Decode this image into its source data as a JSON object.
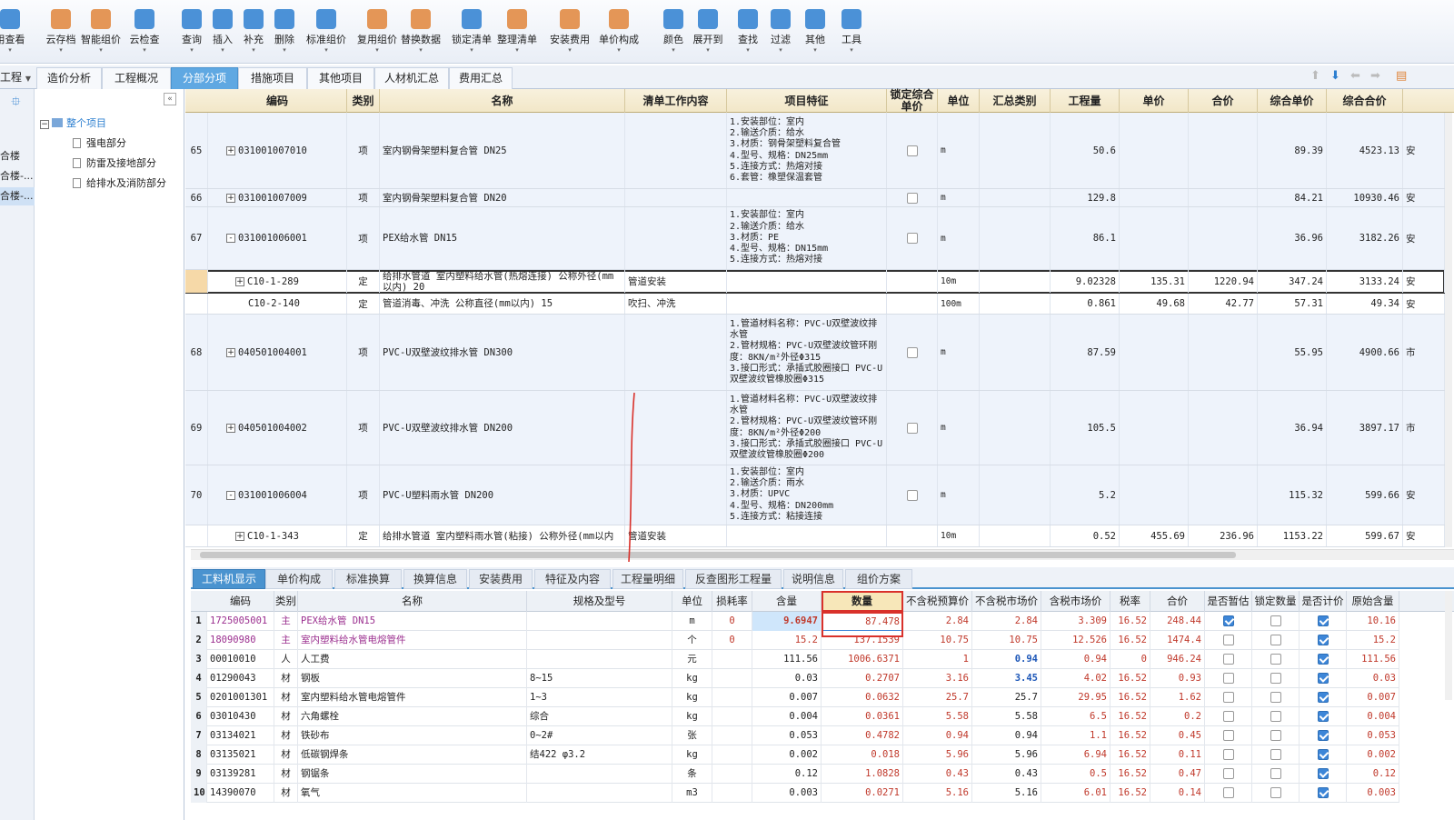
{
  "toolbar": {
    "items": [
      {
        "label": "用查看",
        "icon": "view-icon",
        "color": "#2d7fd0"
      },
      {
        "label": "云存档",
        "icon": "cloud-save-icon",
        "color": "#e0853a"
      },
      {
        "label": "智能组价",
        "icon": "smart-price-icon",
        "color": "#e0853a"
      },
      {
        "label": "云检查",
        "icon": "cloud-check-icon",
        "color": "#2d7fd0"
      },
      {
        "label": "查询",
        "icon": "query-icon",
        "color": "#2d7fd0"
      },
      {
        "label": "插入",
        "icon": "insert-icon",
        "color": "#2d7fd0"
      },
      {
        "label": "补充",
        "icon": "supplement-icon",
        "color": "#2d7fd0"
      },
      {
        "label": "删除",
        "icon": "delete-icon",
        "color": "#2d7fd0"
      },
      {
        "label": "标准组价",
        "icon": "standard-price-icon",
        "color": "#2d7fd0"
      },
      {
        "label": "复用组价",
        "icon": "reuse-price-icon",
        "color": "#e0853a"
      },
      {
        "label": "替换数据",
        "icon": "replace-data-icon",
        "color": "#e0853a"
      },
      {
        "label": "锁定清单",
        "icon": "lock-list-icon",
        "color": "#2d7fd0"
      },
      {
        "label": "整理清单",
        "icon": "organize-list-icon",
        "color": "#e0853a"
      },
      {
        "label": "安装费用",
        "icon": "install-fee-icon",
        "color": "#e0853a"
      },
      {
        "label": "单价构成",
        "icon": "unit-price-icon",
        "color": "#e0853a"
      },
      {
        "label": "颜色",
        "icon": "color-icon",
        "color": "#2d7fd0"
      },
      {
        "label": "展开到",
        "icon": "expand-to-icon",
        "color": "#2d7fd0"
      },
      {
        "label": "查找",
        "icon": "find-icon",
        "color": "#2d7fd0"
      },
      {
        "label": "过滤",
        "icon": "filter-icon",
        "color": "#2d7fd0"
      },
      {
        "label": "其他",
        "icon": "other-icon",
        "color": "#2d7fd0"
      },
      {
        "label": "工具",
        "icon": "tools-icon",
        "color": "#2d7fd0"
      }
    ]
  },
  "tabs": {
    "project_label": "工程",
    "items": [
      "造价分析",
      "工程概况",
      "分部分项",
      "措施项目",
      "其他项目",
      "人材机汇总",
      "费用汇总"
    ],
    "active": "分部分项"
  },
  "left_strip": [
    "合楼",
    "合楼-...",
    "合楼-..."
  ],
  "tree": {
    "root": "整个项目",
    "items": [
      "强电部分",
      "防雷及接地部分",
      "给排水及消防部分"
    ]
  },
  "grid": {
    "headers": [
      "编码",
      "类别",
      "名称",
      "清单工作内容",
      "项目特征",
      "锁定综合单价",
      "单位",
      "汇总类别",
      "工程量",
      "单价",
      "合价",
      "综合单价",
      "综合合价"
    ],
    "rows": [
      {
        "no": "65",
        "code": "031001007010",
        "exp": "+",
        "type": "项",
        "name": "室内钢骨架塑料复合管 DN25",
        "work": "",
        "feat": "1.安装部位：室内\n2.输送介质：给水\n3.材质：钢骨架塑料复合管\n4.型号、规格：DN25mm\n5.连接方式：热熔对接\n6.套管：橡塑保温套管",
        "unit": "m",
        "qty": "50.6",
        "price": "",
        "total": "",
        "cunit": "89.39",
        "ctotal": "4523.13",
        "extra": "安",
        "alt": true
      },
      {
        "no": "66",
        "code": "031001007009",
        "exp": "+",
        "type": "项",
        "name": "室内钢骨架塑料复合管 DN20",
        "work": "",
        "feat": "",
        "unit": "m",
        "qty": "129.8",
        "price": "",
        "total": "",
        "cunit": "84.21",
        "ctotal": "10930.46",
        "extra": "安",
        "alt": true
      },
      {
        "no": "67",
        "code": "031001006001",
        "exp": "-",
        "type": "项",
        "name": "PEX给水管 DN15",
        "work": "",
        "feat": "1.安装部位：室内\n2.输送介质：给水\n3.材质：PE\n4.型号、规格：DN15mm\n5.连接方式：热熔对接",
        "unit": "m",
        "qty": "86.1",
        "price": "",
        "total": "",
        "cunit": "36.96",
        "ctotal": "3182.26",
        "extra": "安",
        "alt": true
      },
      {
        "no": "",
        "code": "C10-1-289",
        "exp": "+",
        "type": "定",
        "name": "给排水管道 室内塑料给水管(热熔连接) 公称外径(mm以内) 20",
        "work": "管道安装",
        "feat": "",
        "unit": "10m",
        "qty": "9.02328",
        "price": "135.31",
        "total": "1220.94",
        "cunit": "347.24",
        "ctotal": "3133.24",
        "extra": "安",
        "alt": false,
        "sel": true
      },
      {
        "no": "",
        "code": "C10-2-140",
        "exp": "",
        "type": "定",
        "name": "管道消毒、冲洗 公称直径(mm以内) 15",
        "work": "吹扫、冲洗",
        "feat": "",
        "unit": "100m",
        "qty": "0.861",
        "price": "49.68",
        "total": "42.77",
        "cunit": "57.31",
        "ctotal": "49.34",
        "extra": "安",
        "alt": false
      },
      {
        "no": "68",
        "code": "040501004001",
        "exp": "+",
        "type": "项",
        "name": "PVC-U双壁波纹排水管 DN300",
        "work": "",
        "feat": "1.管道材料名称：PVC-U双壁波纹排水管\n2.管材规格：PVC-U双壁波纹管环刚度：8KN/m²外径Φ315\n3.接口形式：承插式胶圈接口 PVC-U双壁波纹管橡胶圈Φ315",
        "unit": "m",
        "qty": "87.59",
        "price": "",
        "total": "",
        "cunit": "55.95",
        "ctotal": "4900.66",
        "extra": "市",
        "alt": true
      },
      {
        "no": "69",
        "code": "040501004002",
        "exp": "+",
        "type": "项",
        "name": "PVC-U双壁波纹排水管 DN200",
        "work": "",
        "feat": "1.管道材料名称：PVC-U双壁波纹排水管\n2.管材规格：PVC-U双壁波纹管环刚度：8KN/m²外径Φ200\n3.接口形式：承插式胶圈接口 PVC-U双壁波纹管橡胶圈Φ200",
        "unit": "m",
        "qty": "105.5",
        "price": "",
        "total": "",
        "cunit": "36.94",
        "ctotal": "3897.17",
        "extra": "市",
        "alt": true
      },
      {
        "no": "70",
        "code": "031001006004",
        "exp": "-",
        "type": "项",
        "name": "PVC-U塑料雨水管 DN200",
        "work": "",
        "feat": "1.安装部位：室内\n2.输送介质：雨水\n3.材质：UPVC\n4.型号、规格：DN200mm\n5.连接方式：粘接连接",
        "unit": "m",
        "qty": "5.2",
        "price": "",
        "total": "",
        "cunit": "115.32",
        "ctotal": "599.66",
        "extra": "安",
        "alt": true
      },
      {
        "no": "",
        "code": "C10-1-343",
        "exp": "+",
        "type": "定",
        "name": "给排水管道 室内塑料雨水管(粘接) 公称外径(mm以内",
        "work": "管道安装",
        "feat": "",
        "unit": "10m",
        "qty": "0.52",
        "price": "455.69",
        "total": "236.96",
        "cunit": "1153.22",
        "ctotal": "599.67",
        "extra": "安",
        "alt": false
      }
    ]
  },
  "bottom_tabs": {
    "items": [
      "工料机显示",
      "单价构成",
      "标准换算",
      "换算信息",
      "安装费用",
      "特征及内容",
      "工程量明细",
      "反查图形工程量",
      "说明信息",
      "组价方案"
    ],
    "active": "工料机显示"
  },
  "bottom": {
    "headers": [
      "编码",
      "类别",
      "名称",
      "规格及型号",
      "单位",
      "损耗率",
      "含量",
      "数量",
      "不含税预算价",
      "不含税市场价",
      "含税市场价",
      "税率",
      "合价",
      "是否暂估",
      "锁定数量",
      "是否计价",
      "原始含量"
    ],
    "rows": [
      {
        "n": "1",
        "code": "17250050​01",
        "type": "主",
        "name": "PEX给水管 DN15",
        "spec": "",
        "unit": "m",
        "loss": "0",
        "content": "9.6947",
        "qty": "87.478",
        "pre": "2.84",
        "mkt": "2.84",
        "mkttax": "3.309",
        "tax": "16.52",
        "total": "248.44",
        "est": true,
        "lock": false,
        "calc": true,
        "orig": "10.16",
        "style": "purple"
      },
      {
        "n": "2",
        "code": "18090980",
        "type": "主",
        "name": "室内塑料给水管电熔管件",
        "spec": "",
        "unit": "个",
        "loss": "0",
        "content": "15.2",
        "qty": "137.1539",
        "pre": "10.75",
        "mkt": "10.75",
        "mkttax": "12.526",
        "tax": "16.52",
        "total": "1474.4",
        "est": false,
        "lock": false,
        "calc": true,
        "orig": "15.2",
        "style": "purple"
      },
      {
        "n": "3",
        "code": "00010010",
        "type": "人",
        "name": "人工费",
        "spec": "",
        "unit": "元",
        "loss": "",
        "content": "111.56",
        "qty": "1006.6371",
        "pre": "1",
        "mkt": "0.94",
        "mkttax": "0.94",
        "tax": "0",
        "total": "946.24",
        "est": false,
        "lock": false,
        "calc": true,
        "orig": "111.56",
        "style": "",
        "mktblue": true
      },
      {
        "n": "4",
        "code": "01290043",
        "type": "材",
        "name": "钢板",
        "spec": "8~15",
        "unit": "kg",
        "loss": "",
        "content": "0.03",
        "qty": "0.2707",
        "pre": "3.16",
        "mkt": "3.45",
        "mkttax": "4.02",
        "tax": "16.52",
        "total": "0.93",
        "est": false,
        "lock": false,
        "calc": true,
        "orig": "0.03",
        "style": "",
        "mktblue": true
      },
      {
        "n": "5",
        "code": "0201001301",
        "type": "材",
        "name": "室内塑料给水管电熔管件",
        "spec": "1~3",
        "unit": "kg",
        "loss": "",
        "content": "0.007",
        "qty": "0.0632",
        "pre": "25.7",
        "mkt": "25.7",
        "mkttax": "29.95",
        "tax": "16.52",
        "total": "1.62",
        "est": false,
        "lock": false,
        "calc": true,
        "orig": "0.007",
        "style": ""
      },
      {
        "n": "6",
        "code": "03010430",
        "type": "材",
        "name": "六角螺栓",
        "spec": "综合",
        "unit": "kg",
        "loss": "",
        "content": "0.004",
        "qty": "0.0361",
        "pre": "5.58",
        "mkt": "5.58",
        "mkttax": "6.5",
        "tax": "16.52",
        "total": "0.2",
        "est": false,
        "lock": false,
        "calc": true,
        "orig": "0.004",
        "style": ""
      },
      {
        "n": "7",
        "code": "03134021",
        "type": "材",
        "name": "铁砂布",
        "spec": "0~2#",
        "unit": "张",
        "loss": "",
        "content": "0.053",
        "qty": "0.4782",
        "pre": "0.94",
        "mkt": "0.94",
        "mkttax": "1.1",
        "tax": "16.52",
        "total": "0.45",
        "est": false,
        "lock": false,
        "calc": true,
        "orig": "0.053",
        "style": ""
      },
      {
        "n": "8",
        "code": "03135021",
        "type": "材",
        "name": "低碳钢焊条",
        "spec": "结422 φ3.2",
        "unit": "kg",
        "loss": "",
        "content": "0.002",
        "qty": "0.018",
        "pre": "5.96",
        "mkt": "5.96",
        "mkttax": "6.94",
        "tax": "16.52",
        "total": "0.11",
        "est": false,
        "lock": false,
        "calc": true,
        "orig": "0.002",
        "style": ""
      },
      {
        "n": "9",
        "code": "03139281",
        "type": "材",
        "name": "钢锯条",
        "spec": "",
        "unit": "条",
        "loss": "",
        "content": "0.12",
        "qty": "1.0828",
        "pre": "0.43",
        "mkt": "0.43",
        "mkttax": "0.5",
        "tax": "16.52",
        "total": "0.47",
        "est": false,
        "lock": false,
        "calc": true,
        "orig": "0.12",
        "style": ""
      },
      {
        "n": "10",
        "code": "14390070",
        "type": "材",
        "name": "氧气",
        "spec": "",
        "unit": "m3",
        "loss": "",
        "content": "0.003",
        "qty": "0.0271",
        "pre": "5.16",
        "mkt": "5.16",
        "mkttax": "6.01",
        "tax": "16.52",
        "total": "0.14",
        "est": false,
        "lock": false,
        "calc": true,
        "orig": "0.003",
        "style": ""
      }
    ]
  }
}
